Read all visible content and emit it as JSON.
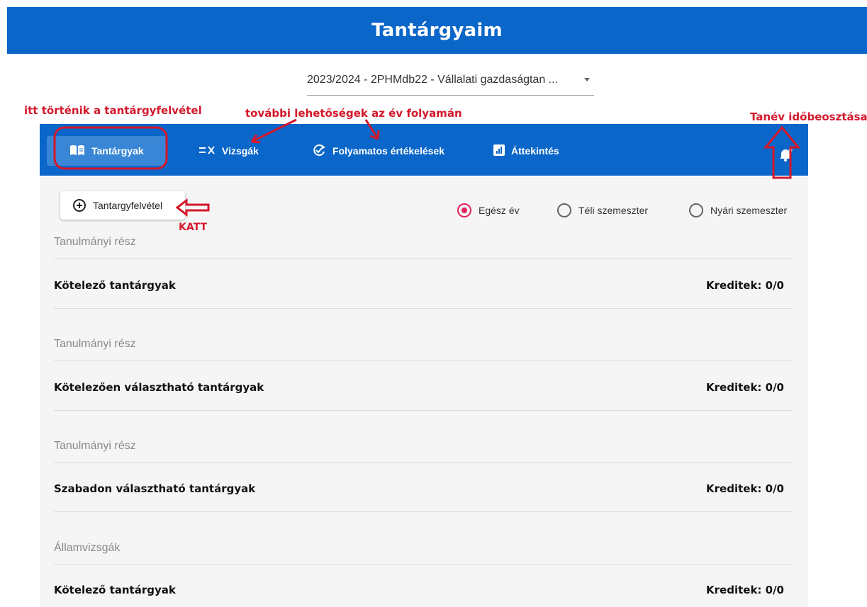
{
  "header": {
    "title": "Tantárgyaim"
  },
  "period_select": {
    "value": "2023/2024 - 2PHMdb22 - Vállalati gazdaságtan ..."
  },
  "annotations": {
    "enrollment_here": "itt történik a tantárgyfelvétel",
    "more_options": "további lehetőségek az év folyamán",
    "schedule": "Tanév időbeosztása",
    "click": "KATT"
  },
  "nav": {
    "items": [
      {
        "label": "Tantárgyak",
        "icon": "book-icon",
        "active": true
      },
      {
        "label": "Vizsgák",
        "icon": "exam-list-icon",
        "active": false
      },
      {
        "label": "Folyamatos értékelések",
        "icon": "refresh-check-icon",
        "active": false
      },
      {
        "label": "Áttekintés",
        "icon": "chart-icon",
        "active": false
      }
    ],
    "bell_icon": "bell-icon"
  },
  "add_button": {
    "label": "Tantargyfelvétel",
    "icon": "plus-circle-icon"
  },
  "semester_filter": {
    "options": [
      {
        "label": "Egész év",
        "selected": true
      },
      {
        "label": "Téli szemeszter",
        "selected": false
      },
      {
        "label": "Nyári szemeszter",
        "selected": false
      }
    ]
  },
  "sections": [
    {
      "label": "Tanulmányi rész",
      "title": "Kötelező tantárgyak",
      "credits": "Kreditek: 0/0"
    },
    {
      "label": "Tanulmányi rész",
      "title": "Kötelezően választható tantárgyak",
      "credits": "Kreditek: 0/0"
    },
    {
      "label": "Tanulmányi rész",
      "title": "Szabadon választható tantárgyak",
      "credits": "Kreditek: 0/0"
    },
    {
      "label": "Államvizsgák",
      "title": "Kötelező tantárgyak",
      "credits": "Kreditek: 0/0"
    }
  ],
  "colors": {
    "primary": "#0a66c8",
    "accent": "#e0245e",
    "annotation": "#d4172a"
  }
}
